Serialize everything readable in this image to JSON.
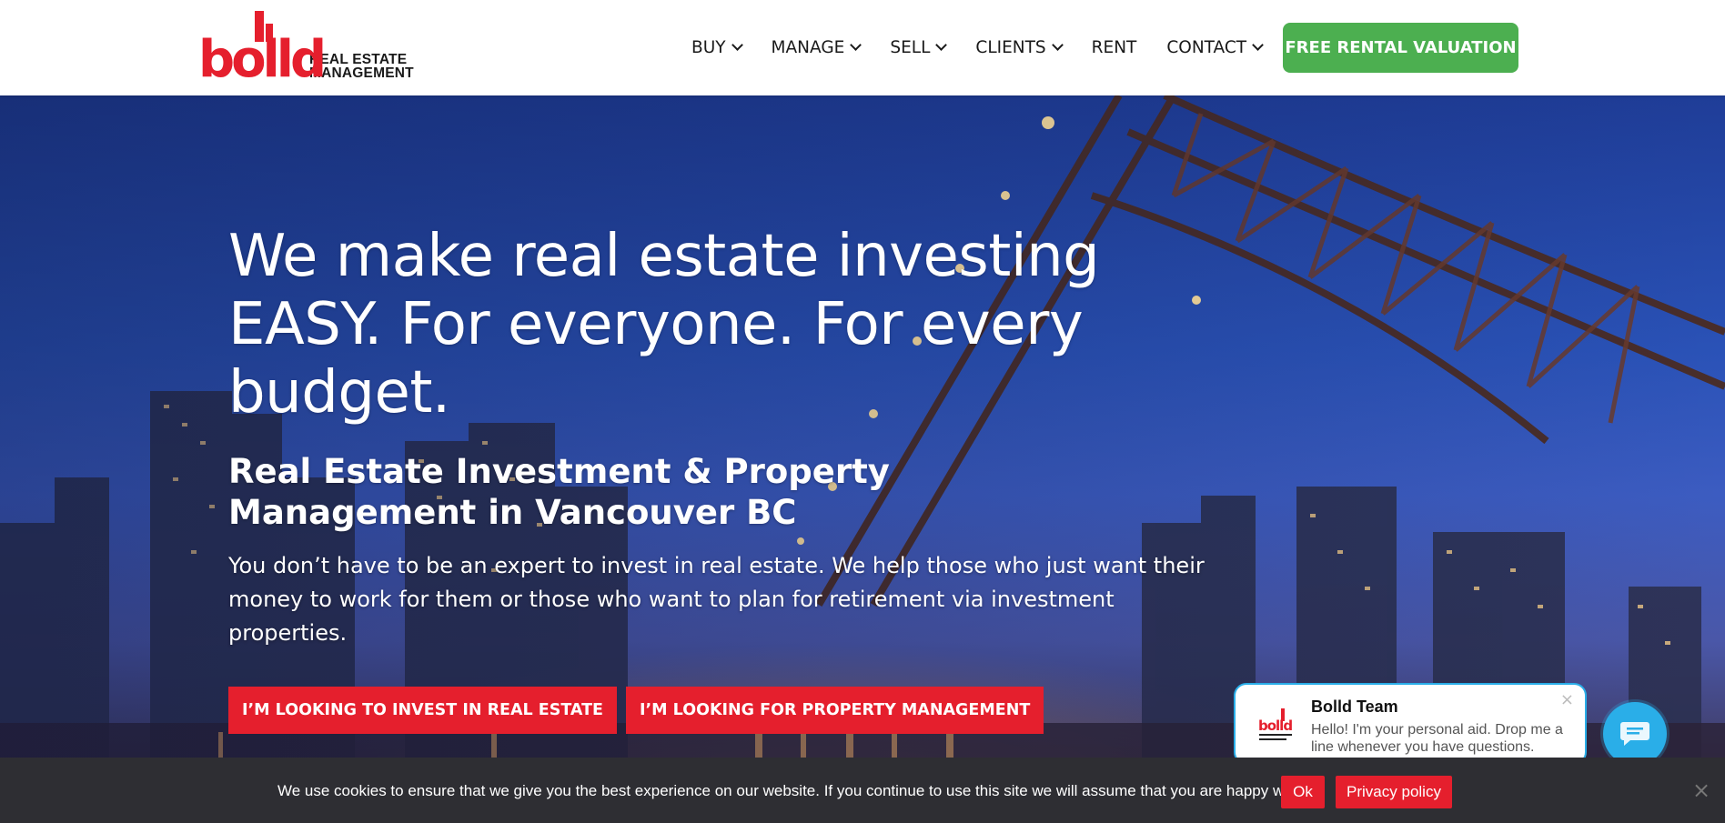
{
  "brand": {
    "logo_word": "bolld",
    "logo_text_line1": "REAL ESTATE",
    "logo_text_line2": "MANAGEMENT",
    "red": "#e51f2d"
  },
  "nav": {
    "items": [
      {
        "label": "BUY",
        "dropdown": true
      },
      {
        "label": "MANAGE",
        "dropdown": true
      },
      {
        "label": "SELL",
        "dropdown": true
      },
      {
        "label": "CLIENTS",
        "dropdown": true
      },
      {
        "label": "RENT",
        "dropdown": false
      },
      {
        "label": "CONTACT",
        "dropdown": true
      }
    ],
    "cta_label": "FREE RENTAL VALUATION",
    "cta_color": "#4caf50"
  },
  "hero": {
    "title": "We make real estate investing EASY. For everyone. For every budget.",
    "subtitle": "Real Estate Investment & Property Management in Vancouver BC",
    "body": "You don’t have to be an expert to invest in real estate. We help those who just want their money to work for them or those who want to plan for retirement via investment properties.",
    "button_invest": "I’M LOOKING TO INVEST IN REAL ESTATE",
    "button_management": "I’M LOOKING FOR PROPERTY MANAGEMENT",
    "background_icon": "city-bridge-night-photo"
  },
  "chat": {
    "name": "Bolld Team",
    "message": "Hello! I'm your personal aid. Drop me a line whenever you have questions.",
    "close_symbol": "×",
    "accent": "#2aaee8",
    "fab_icon": "chat-bubble-icon"
  },
  "cookie": {
    "text": "We use cookies to ensure that we give you the best experience on our website. If you continue to use this site we will assume that you are happy with it.",
    "ok_label": "Ok",
    "privacy_label": "Privacy policy",
    "close_symbol": "×"
  }
}
